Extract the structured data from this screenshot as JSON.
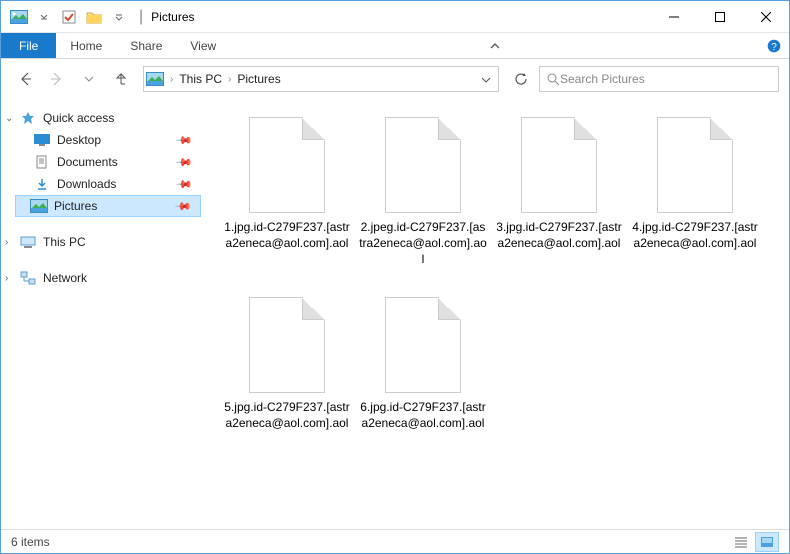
{
  "title": "Pictures",
  "ribbon": {
    "file": "File",
    "tabs": [
      "Home",
      "Share",
      "View"
    ]
  },
  "breadcrumb": [
    "This PC",
    "Pictures"
  ],
  "search_placeholder": "Search Pictures",
  "sidebar": {
    "quick_access": {
      "label": "Quick access",
      "items": [
        {
          "label": "Desktop",
          "pinned": true
        },
        {
          "label": "Documents",
          "pinned": true
        },
        {
          "label": "Downloads",
          "pinned": true
        },
        {
          "label": "Pictures",
          "pinned": true,
          "selected": true
        }
      ]
    },
    "this_pc": {
      "label": "This PC"
    },
    "network": {
      "label": "Network"
    }
  },
  "files": [
    {
      "name": "1.jpg.id-C279F237.[astra2eneca@aol.com].aol"
    },
    {
      "name": "2.jpeg.id-C279F237.[astra2eneca@aol.com].aol"
    },
    {
      "name": "3.jpg.id-C279F237.[astra2eneca@aol.com].aol"
    },
    {
      "name": "4.jpg.id-C279F237.[astra2eneca@aol.com].aol"
    },
    {
      "name": "5.jpg.id-C279F237.[astra2eneca@aol.com].aol"
    },
    {
      "name": "6.jpg.id-C279F237.[astra2eneca@aol.com].aol"
    }
  ],
  "status": {
    "count": "6 items"
  }
}
